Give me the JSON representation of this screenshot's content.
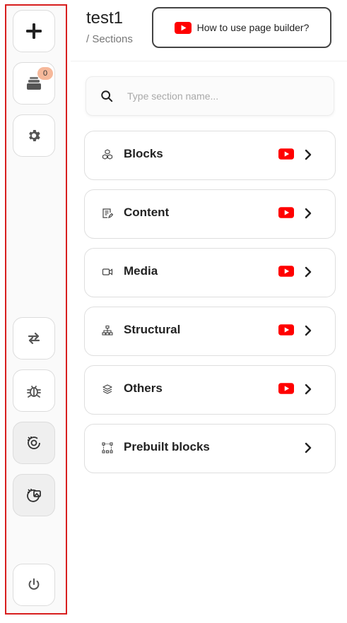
{
  "sidebar": {
    "buttons": [
      {
        "name": "add-section-button",
        "icon": "plus-icon"
      },
      {
        "name": "layers-button",
        "icon": "stack-icon",
        "badge": "0"
      },
      {
        "name": "settings-button",
        "icon": "gear-icon"
      },
      {
        "name": "swap-button",
        "icon": "swap-arrows-icon"
      },
      {
        "name": "debug-button",
        "icon": "bug-icon"
      },
      {
        "name": "ai-settings-button",
        "icon": "ai-gear-icon"
      },
      {
        "name": "ai-image-button",
        "icon": "ai-image-icon"
      },
      {
        "name": "power-button",
        "icon": "power-icon"
      }
    ],
    "layers_badge": "0"
  },
  "header": {
    "title": "test1",
    "breadcrumb": "/ Sections",
    "howto_label": "How to use page builder?"
  },
  "search": {
    "placeholder": "Type section name...",
    "value": ""
  },
  "sections": [
    {
      "label": "Blocks",
      "icon": "cubes-icon",
      "video": true
    },
    {
      "label": "Content",
      "icon": "document-edit-icon",
      "video": true
    },
    {
      "label": "Media",
      "icon": "video-camera-icon",
      "video": true
    },
    {
      "label": "Structural",
      "icon": "hierarchy-icon",
      "video": true
    },
    {
      "label": "Others",
      "icon": "layers-icon",
      "video": true
    },
    {
      "label": "Prebuilt blocks",
      "icon": "prebuilt-grid-icon",
      "video": false
    }
  ],
  "colors": {
    "sidebar_outline": "#d81e1e",
    "youtube_red": "#ff0000",
    "badge": "#f6b89a"
  }
}
